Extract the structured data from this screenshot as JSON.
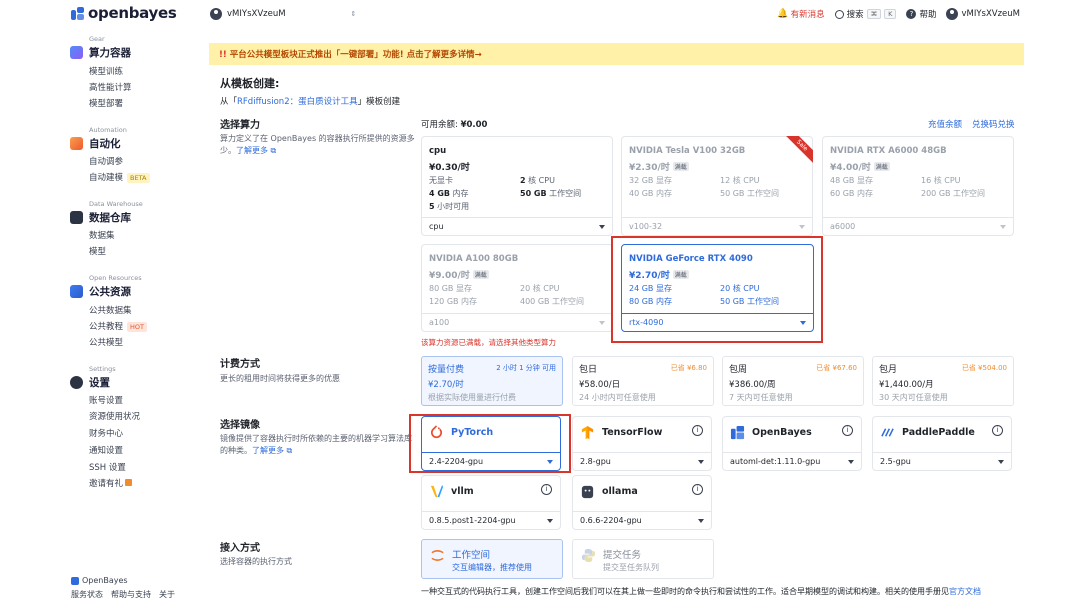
{
  "brand": {
    "name": "openbayes"
  },
  "sidebar": {
    "sections": [
      {
        "en": "Gear",
        "title": "算力容器",
        "items": [
          "模型训练",
          "高性能计算",
          "模型部署"
        ]
      },
      {
        "en": "Automation",
        "title": "自动化",
        "items": [
          "自动调参",
          "自动建模"
        ],
        "tag": "BETA"
      },
      {
        "en": "Data Warehouse",
        "title": "数据仓库",
        "items": [
          "数据集",
          "模型"
        ]
      },
      {
        "en": "Open Resources",
        "title": "公共资源",
        "items": [
          "公共数据集",
          "公共教程",
          "公共模型"
        ],
        "tag": "HOT"
      },
      {
        "en": "Settings",
        "title": "设置",
        "items": [
          "账号设置",
          "资源使用状况",
          "财务中心",
          "通知设置",
          "SSH 设置",
          "邀请有礼"
        ]
      }
    ],
    "footer_brand": "OpenBayes",
    "footer_links": [
      "服务状态",
      "帮助与支持",
      "关于"
    ]
  },
  "topbar": {
    "account": "vMIYsXVzeuM",
    "news": "有新消息",
    "search": "搜索",
    "kbd1": "⌘",
    "kbd2": "K",
    "help": "帮助",
    "user": "vMIYsXVzeuM"
  },
  "banner": {
    "mark": "!!",
    "text": "平台公共模型板块正式推出「一键部署」功能! 点击了解更多详情→"
  },
  "page": {
    "title": "从模板创建:",
    "from_prefix": "从「",
    "from_link": "RFdiffusion2：蛋白质设计工具",
    "from_suffix": "」模板创建"
  },
  "compute": {
    "label": "选择算力",
    "desc": "算力定义了在 OpenBayes 的容器执行所提供的资源多少。",
    "learn": "了解更多",
    "balance_label": "可用余额:",
    "balance": "¥0.00",
    "recharge": "充值余额",
    "redeem": "兑换码兑换",
    "sale": "Sale",
    "full_badge": "满载",
    "cards": [
      {
        "name": "cpu",
        "price": "¥0.30/时",
        "a1": "无显卡",
        "a2": "2 核 CPU",
        "b1": "4 GB 内存",
        "b2": "50 GB 工作空间",
        "c1": "5 小时可用",
        "select": "cpu"
      },
      {
        "name": "NVIDIA Tesla V100 32GB",
        "price": "¥2.30/时",
        "a1": "32 GB 显存",
        "a2": "12 核 CPU",
        "b1": "40 GB 内存",
        "b2": "50 GB 工作空间",
        "select": "v100-32"
      },
      {
        "name": "NVIDIA RTX A6000 48GB",
        "price": "¥4.00/时",
        "a1": "48 GB 显存",
        "a2": "16 核 CPU",
        "b1": "60 GB 内存",
        "b2": "200 GB 工作空间",
        "select": "a6000"
      },
      {
        "name": "NVIDIA A100 80GB",
        "price": "¥9.00/时",
        "a1": "80 GB 显存",
        "a2": "20 核 CPU",
        "b1": "120 GB 内存",
        "b2": "400 GB 工作空间",
        "select": "a100"
      },
      {
        "name": "NVIDIA GeForce RTX 4090",
        "price": "¥2.70/时",
        "a1": "24 GB 显存",
        "a2": "20 核 CPU",
        "b1": "80 GB 内存",
        "b2": "50 GB 工作空间",
        "select": "rtx-4090"
      }
    ],
    "warning": "该算力资源已满载，请选择其他类型算力"
  },
  "billing": {
    "label": "计费方式",
    "desc": "更长的租用时间将获得更多的优惠",
    "options": [
      {
        "t": "按量付费",
        "r": "2 小时 1 分钟 可用",
        "p": "¥2.70/时",
        "s": "根据实际使用量进行付费"
      },
      {
        "t": "包日",
        "r": "已省 ¥6.80",
        "p": "¥58.00/日",
        "s": "24 小时内可任意使用"
      },
      {
        "t": "包周",
        "r": "已省 ¥67.60",
        "p": "¥386.00/周",
        "s": "7 天内可任意使用"
      },
      {
        "t": "包月",
        "r": "已省 ¥504.00",
        "p": "¥1,440.00/月",
        "s": "30 天内可任意使用"
      }
    ]
  },
  "image": {
    "label": "选择镜像",
    "desc": "镜像提供了容器执行时所依赖的主要的机器学习算法库的种类。",
    "learn": "了解更多",
    "info": "i",
    "options": [
      {
        "name": "PyTorch",
        "version": "2.4-2204-gpu"
      },
      {
        "name": "TensorFlow",
        "version": "2.8-gpu"
      },
      {
        "name": "OpenBayes",
        "version": "automl-det:1.11.0-gpu"
      },
      {
        "name": "PaddlePaddle",
        "version": "2.5-gpu"
      },
      {
        "name": "vllm",
        "version": "0.8.5.post1-2204-gpu"
      },
      {
        "name": "ollama",
        "version": "0.6.6-2204-gpu"
      }
    ]
  },
  "access": {
    "label": "接入方式",
    "desc": "选择容器的执行方式",
    "options": [
      {
        "name": "工作空间",
        "sub": "交互编辑器，推荐使用"
      },
      {
        "name": "提交任务",
        "sub": "提交至任务队列"
      }
    ],
    "bottom": "一种交互式的代码执行工具，创建工作空间后我们可以在其上做一些即时的命令执行和尝试性的工作。适合早期模型的调试和构建。相关的使用手册见",
    "bottom_link": "官方文档"
  },
  "colors": {
    "accent": "#2f6bdb",
    "highlight": "#d8352c",
    "banner": "#fff1a8"
  }
}
